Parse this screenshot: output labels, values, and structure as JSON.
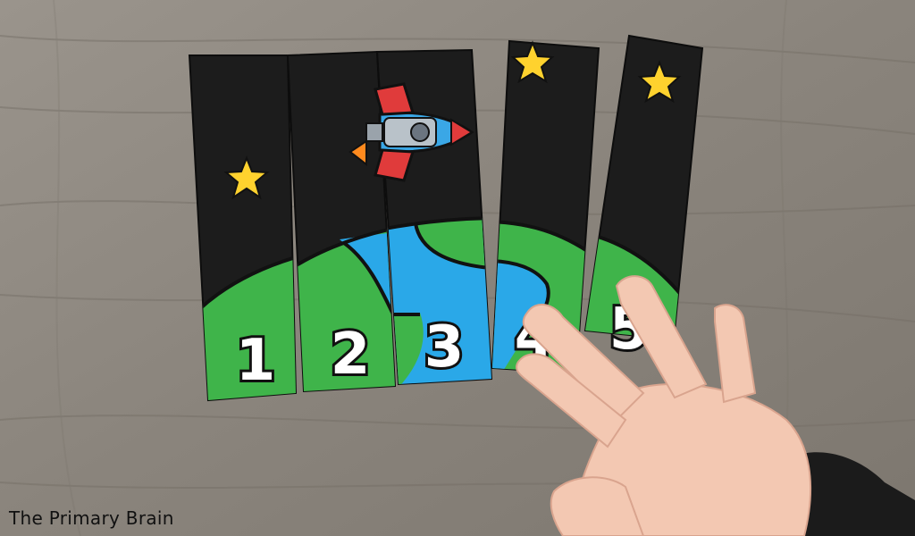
{
  "image": {
    "subject": "Number sequencing puzzle strips",
    "watermark": "The Primary Brain",
    "strip_numbers": [
      "1",
      "2",
      "3",
      "4",
      "5"
    ]
  },
  "colors": {
    "wood": "#8a847c",
    "sky": "#1c1c1c",
    "land": "#3fb44a",
    "water": "#2aa8e8",
    "star": "#ffd22e",
    "rocket_body": "#3aa7e6",
    "rocket_fin": "#e03b3b",
    "skin": "#f3c8b2",
    "sleeve": "#1b1b1b"
  }
}
